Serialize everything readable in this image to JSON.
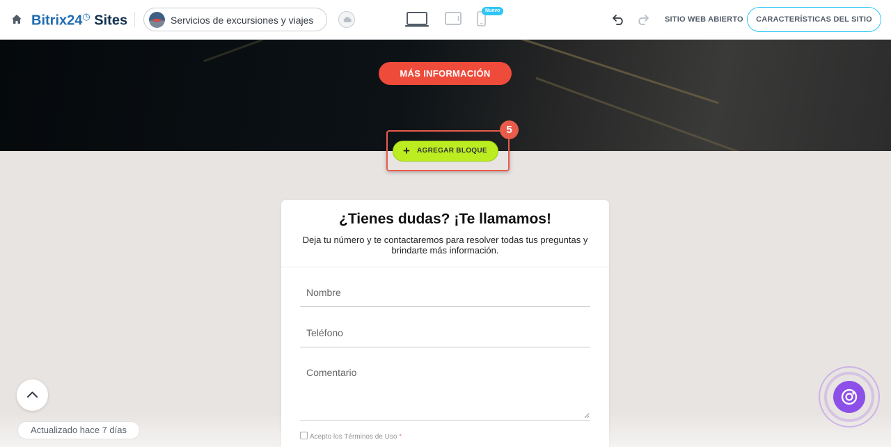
{
  "topbar": {
    "brand_name": "Bitrix24",
    "brand_product": "Sites",
    "site_name": "Servicios de excursiones y viajes",
    "new_badge": "Nuevo",
    "open_site": "SITIO WEB ABIERTO",
    "site_features": "CARACTERÍSTICAS DEL SITIO"
  },
  "hero": {
    "more_info_button": "MÁS INFORMACIÓN"
  },
  "add_block": {
    "label": "AGREGAR BLOQUE",
    "step": "5"
  },
  "form": {
    "title": "¿Tienes dudas? ¡Te llamamos!",
    "description": "Deja tu número y te contactaremos para resolver todas tus preguntas y brindarte más información.",
    "name_placeholder": "Nombre",
    "phone_placeholder": "Teléfono",
    "comment_placeholder": "Comentario",
    "terms_label": "Acepto los Términos de Uso",
    "terms_required": "*"
  },
  "footer": {
    "updated": "Actualizado hace 7 días"
  },
  "icons": {
    "home": "home-icon",
    "cloud": "cloud-icon",
    "desktop": "desktop-icon",
    "tablet": "tablet-icon",
    "mobile": "mobile-icon",
    "undo": "undo-icon",
    "redo": "redo-icon",
    "scroll_up": "chevron-up-icon",
    "assistant": "copilot-icon"
  },
  "colors": {
    "brand_blue": "#1f6bb0",
    "accent_cyan": "#2fc6f6",
    "more_info_red": "#ef4b3b",
    "add_block_green": "#bbed21",
    "highlight_red": "#e85c4b",
    "assistant_purple": "#8c4fe8"
  }
}
